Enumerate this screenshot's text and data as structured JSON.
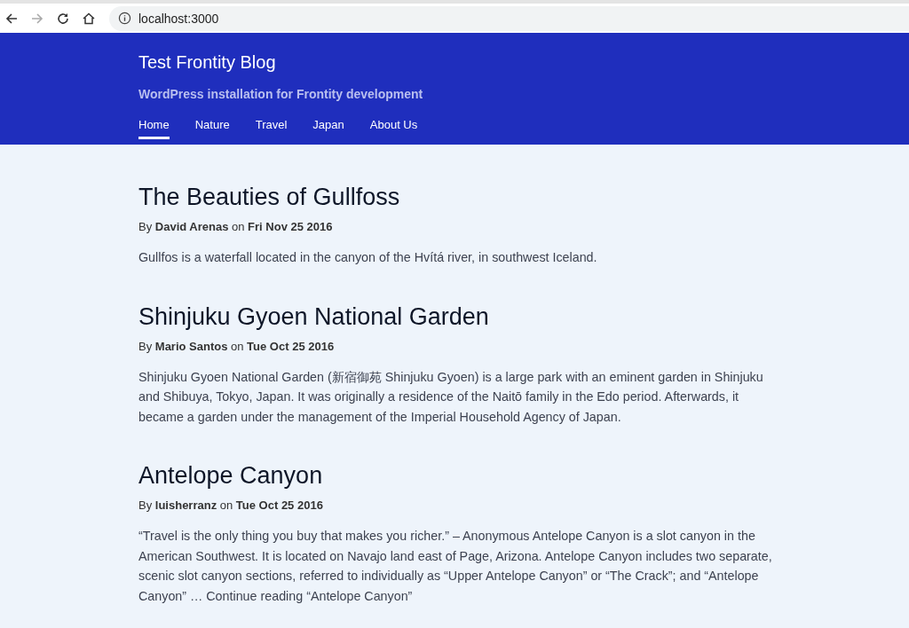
{
  "browser": {
    "url": "localhost:3000"
  },
  "site": {
    "title": "Test Frontity Blog",
    "description": "WordPress installation for Frontity development"
  },
  "nav": [
    {
      "label": "Home",
      "selected": true
    },
    {
      "label": "Nature",
      "selected": false
    },
    {
      "label": "Travel",
      "selected": false
    },
    {
      "label": "Japan",
      "selected": false
    },
    {
      "label": "About Us",
      "selected": false
    }
  ],
  "posts": [
    {
      "title": "The Beauties of Gullfoss",
      "byline": "By **David Arenas** on **Fri Nov 25 2016**",
      "excerpt": "Gullfos is a waterfall located in the canyon of the Hvítá river, in southwest Iceland."
    },
    {
      "title": "Shinjuku Gyoen National Garden",
      "byline": "By **Mario Santos** on **Tue Oct 25 2016**",
      "excerpt": "Shinjuku Gyoen National Garden (新宿御苑 Shinjuku Gyoen) is a large park with an eminent garden in Shinjuku and Shibuya, Tokyo, Japan. It was originally a residence of the Naitō family in the Edo period. Afterwards, it became a garden under the management of the Imperial Household Agency of Japan."
    },
    {
      "title": "Antelope Canyon",
      "byline": "By **luisherranz** on **Tue Oct 25 2016**",
      "excerpt": "“Travel is the only thing you buy that makes you richer.” – Anonymous Antelope Canyon is a slot canyon in the American Southwest. It is located on Navajo land east of Page, Arizona. Antelope Canyon includes two separate, scenic slot canyon sections, referred to individually as “Upper Antelope Canyon” or “The Crack”; and “Antelope Canyon” … Continue reading “Antelope Canyon”"
    }
  ]
}
